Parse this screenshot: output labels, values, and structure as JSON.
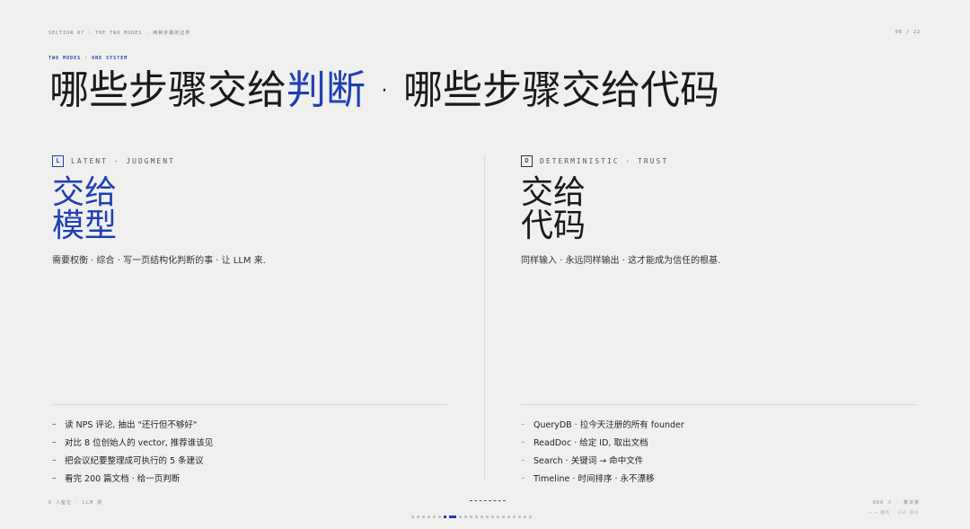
{
  "topbar": {
    "section": "SECTION 07 · THE TWO MODES · 两种步骤的边界",
    "page": "08 / 22"
  },
  "eyebrow": "TWO MODES · ONE SYSTEM",
  "title": {
    "part1": "哪些步骤交给",
    "highlight": "判断",
    "part2": " · 哪些步骤交给代码"
  },
  "left": {
    "tag_letter": "L",
    "tag_label": "LATENT · JUDGMENT",
    "big_line1": "交给",
    "big_line2": "模型",
    "lead": "需要权衡 · 综合 · 写一页结构化判断的事 · 让 LLM 来.",
    "items": [
      "读 NPS 评论, 抽出 \"还行但不够好\"",
      "对比 8 位创始人的 vector, 推荐谁该见",
      "把会议纪要整理成可执行的 5 条建议",
      "看完 200 篇文档 · 给一页判断"
    ]
  },
  "right": {
    "tag_letter": "D",
    "tag_label": "DETERMINISTIC · TRUST",
    "big_line1": "交给",
    "big_line2": "代码",
    "lead": "同样输入 · 永远同样输出 · 这才能成为信任的根基.",
    "items": [
      "QueryDB · 拉今天注册的所有 founder",
      "ReadDoc · 给定 ID, 取出文档",
      "Search · 关键词 → 命中文件",
      "Timeline · 时间排序 · 永不漂移"
    ]
  },
  "footer": {
    "left": "6 人座位 · LLM 排",
    "right": "800 人 · 算法排",
    "hint": "← → 翻页 · ESC 索引"
  },
  "dots": {
    "count": 22,
    "active_index": 7
  },
  "colors": {
    "accent": "#1f3fb5",
    "background": "#f0f0ee"
  }
}
